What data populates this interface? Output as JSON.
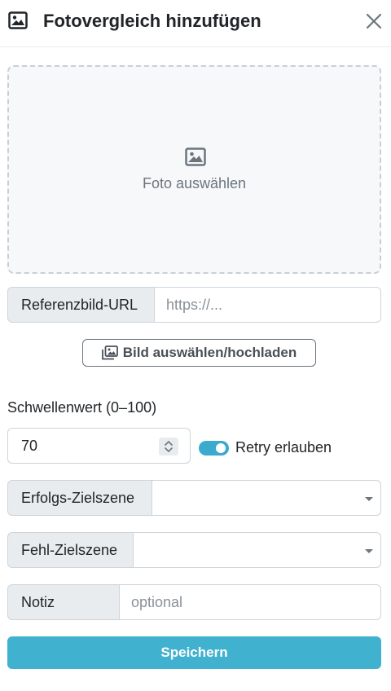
{
  "header": {
    "title": "Fotovergleich hinzufügen",
    "title_icon": "image-icon",
    "close_icon": "close-icon"
  },
  "dropzone": {
    "icon": "image-icon",
    "label": "Foto auswählen"
  },
  "reference_url": {
    "label": "Referenzbild-URL",
    "placeholder": "https://...",
    "value": ""
  },
  "upload_button": {
    "label": "Bild auswählen/hochladen",
    "icon": "images-icon"
  },
  "threshold": {
    "label": "Schwellenwert (0–100)",
    "value": "70"
  },
  "retry": {
    "label": "Retry erlauben",
    "enabled": true
  },
  "success_scene": {
    "label": "Erfolgs-Zielszene",
    "value": ""
  },
  "fail_scene": {
    "label": "Fehl-Zielszene",
    "value": ""
  },
  "note": {
    "label": "Notiz",
    "placeholder": "optional",
    "value": ""
  },
  "save_button": {
    "label": "Speichern"
  },
  "colors": {
    "accent": "#41b1d0",
    "toggle_on": "#3aabcc",
    "addon_bg": "#e9ecef",
    "dropzone_bg": "#f7f8fa"
  }
}
